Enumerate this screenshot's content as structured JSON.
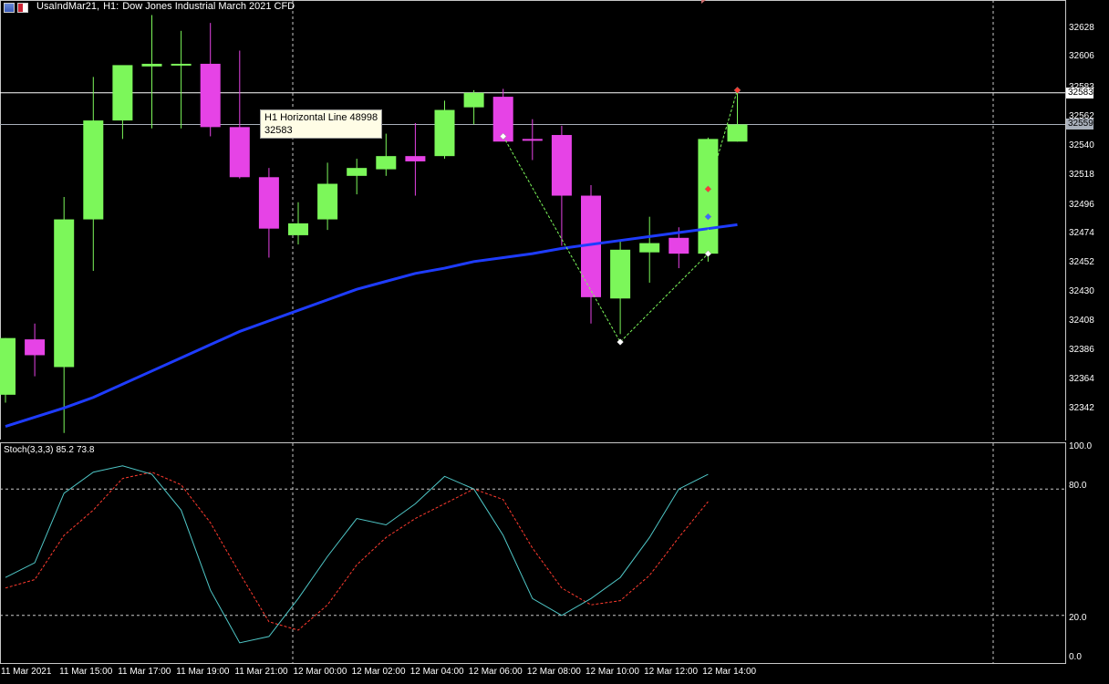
{
  "header": {
    "symbol": "UsaIndMar21,",
    "timeframe": "H1:",
    "description": "Dow Jones Industrial March 2021 CFD"
  },
  "tooltip": {
    "line1": "H1 Horizontal Line 48998",
    "line2": "32583"
  },
  "price_axis": {
    "ticks": [
      "32628",
      "32606",
      "32583",
      "32562",
      "32540",
      "32518",
      "32496",
      "32474",
      "32452",
      "32430",
      "32408",
      "32386",
      "32364",
      "32342"
    ],
    "markers": [
      {
        "label": "32583",
        "value": 32583,
        "bg": "#ffffff"
      },
      {
        "label": "32559",
        "value": 32559,
        "bg": "#a9b0bb"
      }
    ]
  },
  "horizontal_lines": [
    {
      "value": 32583,
      "color": "#ffffff"
    },
    {
      "value": 32559,
      "color": "#a9b0bb"
    }
  ],
  "time_axis": [
    "11 Mar 2021",
    "11 Mar 15:00",
    "11 Mar 17:00",
    "11 Mar 19:00",
    "11 Mar 21:00",
    "12 Mar 00:00",
    "12 Mar 02:00",
    "12 Mar 04:00",
    "12 Mar 06:00",
    "12 Mar 08:00",
    "12 Mar 10:00",
    "12 Mar 12:00",
    "12 Mar 14:00"
  ],
  "stochastic": {
    "name": "Stoch(3,3,3)",
    "main_value": "85.2",
    "signal_value": "73.8",
    "ticks": [
      "100.0",
      "80.0",
      "20.0",
      "0.0"
    ],
    "levels": [
      80,
      20
    ]
  },
  "colors": {
    "bull": "#7cf75a",
    "bear": "#e643e6",
    "ma": "#1e3cff",
    "stoch_main": "#4fc7c7",
    "stoch_signal": "#ff3b2f",
    "zigzag": "#7cf75a"
  },
  "chart_data": {
    "type": "candlestick",
    "candles": [
      {
        "o": 32354,
        "h": 32397,
        "l": 32348,
        "c": 32397
      },
      {
        "o": 32396,
        "h": 32408,
        "l": 32368,
        "c": 32384
      },
      {
        "o": 32375,
        "h": 32504,
        "l": 32325,
        "c": 32487
      },
      {
        "o": 32487,
        "h": 32595,
        "l": 32448,
        "c": 32562
      },
      {
        "o": 32562,
        "h": 32595,
        "l": 32548,
        "c": 32604
      },
      {
        "o": 32603,
        "h": 32642,
        "l": 32556,
        "c": 32605
      },
      {
        "o": 32605,
        "h": 32630,
        "l": 32556,
        "c": 32605
      },
      {
        "o": 32605,
        "h": 32636,
        "l": 32550,
        "c": 32557
      },
      {
        "o": 32557,
        "h": 32615,
        "l": 32518,
        "c": 32519
      },
      {
        "o": 32519,
        "h": 32526,
        "l": 32458,
        "c": 32480
      },
      {
        "o": 32475,
        "h": 32500,
        "l": 32468,
        "c": 32484
      },
      {
        "o": 32487,
        "h": 32530,
        "l": 32479,
        "c": 32514
      },
      {
        "o": 32520,
        "h": 32533,
        "l": 32506,
        "c": 32526
      },
      {
        "o": 32525,
        "h": 32552,
        "l": 32520,
        "c": 32535
      },
      {
        "o": 32535,
        "h": 32560,
        "l": 32505,
        "c": 32531
      },
      {
        "o": 32535,
        "h": 32577,
        "l": 32533,
        "c": 32570
      },
      {
        "o": 32572,
        "h": 32585,
        "l": 32559,
        "c": 32583
      },
      {
        "o": 32580,
        "h": 32586,
        "l": 32548,
        "c": 32546
      },
      {
        "o": 32548,
        "h": 32563,
        "l": 32532,
        "c": 32547
      },
      {
        "o": 32551,
        "h": 32558,
        "l": 32467,
        "c": 32505
      },
      {
        "o": 32505,
        "h": 32513,
        "l": 32408,
        "c": 32428
      },
      {
        "o": 32427,
        "h": 32471,
        "l": 32400,
        "c": 32464
      },
      {
        "o": 32462,
        "h": 32489,
        "l": 32439,
        "c": 32469
      },
      {
        "o": 32473,
        "h": 32481,
        "l": 32450,
        "c": 32461
      },
      {
        "o": 32461,
        "h": 32549,
        "l": 32455,
        "c": 32548
      },
      {
        "o": 32546,
        "h": 32584,
        "l": 32546,
        "c": 32559
      }
    ],
    "ma": [
      32330,
      32337,
      32344,
      32352,
      32362,
      32372,
      32382,
      32392,
      32402,
      32410,
      32418,
      32426,
      32434,
      32440,
      32446,
      32450,
      32455,
      32458,
      32461,
      32465,
      32468,
      32471,
      32474,
      32477,
      32480,
      32483
    ],
    "zigzag": [
      [
        17,
        32550
      ],
      [
        21,
        32394
      ],
      [
        24,
        32461
      ],
      [
        24,
        32489
      ],
      [
        24,
        32510
      ],
      [
        25,
        32585
      ]
    ],
    "stoch_main": [
      38,
      45,
      78,
      88,
      91,
      87,
      70,
      32,
      7,
      10,
      28,
      48,
      66,
      63,
      73,
      86,
      80,
      58,
      28,
      20,
      28,
      38,
      57,
      80,
      87
    ],
    "stoch_signal": [
      33,
      37,
      58,
      70,
      85,
      88,
      82,
      64,
      40,
      17,
      13,
      25,
      44,
      57,
      66,
      73,
      80,
      75,
      52,
      33,
      25,
      27,
      39,
      57,
      74
    ],
    "ylim": [
      32320,
      32652
    ]
  }
}
